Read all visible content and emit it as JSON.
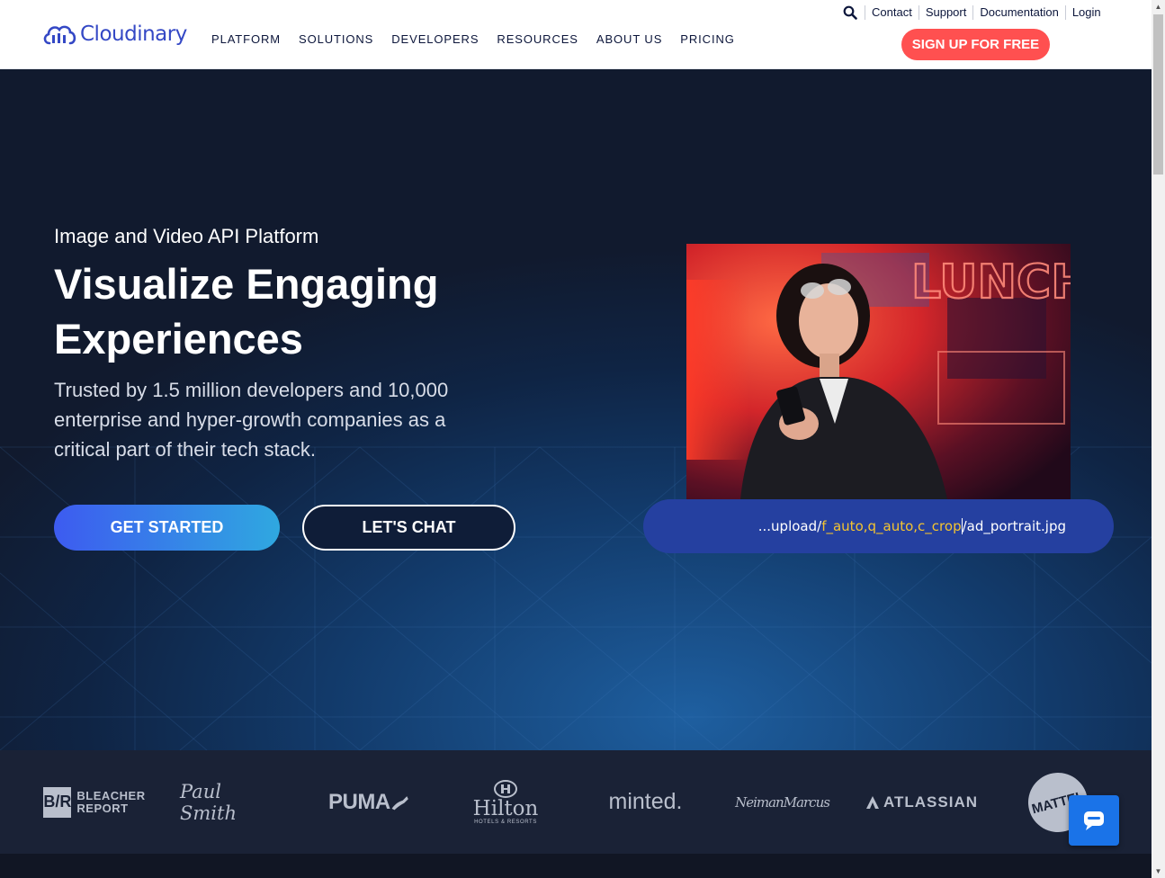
{
  "header": {
    "logo_text": "Cloudinary",
    "nav": [
      "PLATFORM",
      "SOLUTIONS",
      "DEVELOPERS",
      "RESOURCES",
      "ABOUT US",
      "PRICING"
    ],
    "util_links": [
      "Contact",
      "Support",
      "Documentation",
      "Login"
    ],
    "signup_label": "SIGN UP FOR FREE"
  },
  "hero": {
    "eyebrow": "Image and Video API Platform",
    "headline": "Visualize Engaging Experiences",
    "subtext": "Trusted by 1.5 million developers and 10,000 enterprise and hyper-growth companies as a critical part of their tech stack.",
    "cta_primary": "GET STARTED",
    "cta_secondary": "LET'S CHAT",
    "url_prefix": "...upload/",
    "url_transform": "f_auto,q_auto,c_crop",
    "url_suffix": "/ad_portrait.jpg",
    "photo_sign": "LUNCH DINER"
  },
  "logos": {
    "bleacher_mark": "B/R",
    "bleacher_line1": "BLEACHER",
    "bleacher_line2": "REPORT",
    "paul_smith": "Paul Smith",
    "puma": "PUMA",
    "hilton": "Hilton",
    "hilton_sub": "HOTELS & RESORTS",
    "minted": "minted.",
    "neiman": "NeimanMarcus",
    "atlassian": "ATLASSIAN",
    "mattel": "MATTEL"
  },
  "colors": {
    "brand_blue": "#3448c5",
    "signup_red": "#ff5050",
    "url_highlight": "#f4c430",
    "chat_blue": "#1a73e8"
  }
}
